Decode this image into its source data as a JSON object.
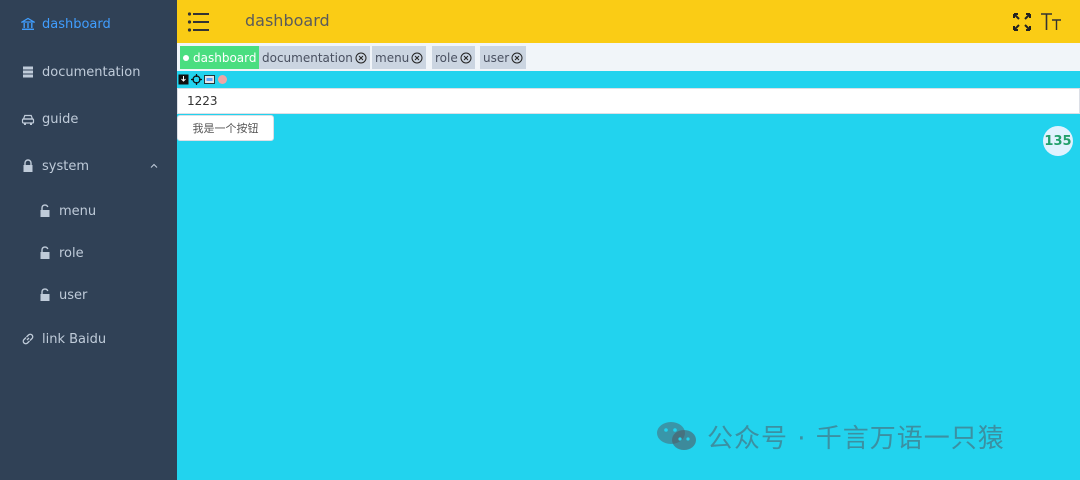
{
  "sidebar": {
    "items": [
      {
        "label": "dashboard",
        "icon": "bank-icon",
        "active": true
      },
      {
        "label": "documentation",
        "icon": "server-icon"
      },
      {
        "label": "guide",
        "icon": "car-icon"
      },
      {
        "label": "system",
        "icon": "lock-icon",
        "expanded": true
      },
      {
        "label": "menu",
        "icon": "lock-open-icon"
      },
      {
        "label": "role",
        "icon": "lock-open-icon"
      },
      {
        "label": "user",
        "icon": "lock-open-icon"
      },
      {
        "label": "link Baidu",
        "icon": "link-icon"
      }
    ],
    "colors": {
      "bg": "#304156",
      "text": "#bfcbd9",
      "active": "#409eff"
    }
  },
  "header": {
    "title": "dashboard",
    "bg": "#facc15"
  },
  "tags": [
    {
      "label": "dashboard",
      "active": true
    },
    {
      "label": "documentation"
    },
    {
      "label": "menu"
    },
    {
      "label": "role"
    },
    {
      "label": "user"
    }
  ],
  "main": {
    "input_value": "1223",
    "button_label": "我是一个按钮",
    "badge_text": "135",
    "bg": "#22d3ee"
  },
  "watermark": {
    "text": "公众号 · 千言万语一只猿"
  }
}
